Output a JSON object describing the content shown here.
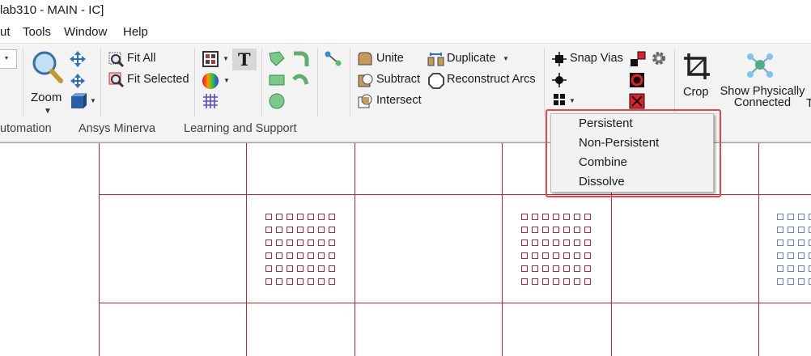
{
  "window": {
    "title": "lab310 - MAIN - IC]"
  },
  "menubar": {
    "items": [
      "ut",
      "Tools",
      "Window",
      "Help"
    ]
  },
  "ribbon": {
    "zoom_label": "Zoom",
    "fit_all": "Fit All",
    "fit_selected": "Fit Selected",
    "unite": "Unite",
    "subtract": "Subtract",
    "intersect": "Intersect",
    "duplicate": "Duplicate",
    "reconstruct_arcs": "Reconstruct Arcs",
    "snap_vias": "Snap Vias",
    "crop": "Crop",
    "show_physically_connected_line1": "Show Physically",
    "show_physically_connected_line2": "Connected",
    "cut_off_letter": "T"
  },
  "tabs": [
    "utomation",
    "Ansys Minerva",
    "Learning and Support"
  ],
  "dropdown": {
    "items": [
      "Persistent",
      "Non-Persistent",
      "Combine",
      "Dissolve"
    ]
  },
  "colors": {
    "grid_line": "#b02a35",
    "via_red": "#b02a35",
    "via_blue": "#6a7fc7",
    "highlight": "#e0474c"
  }
}
